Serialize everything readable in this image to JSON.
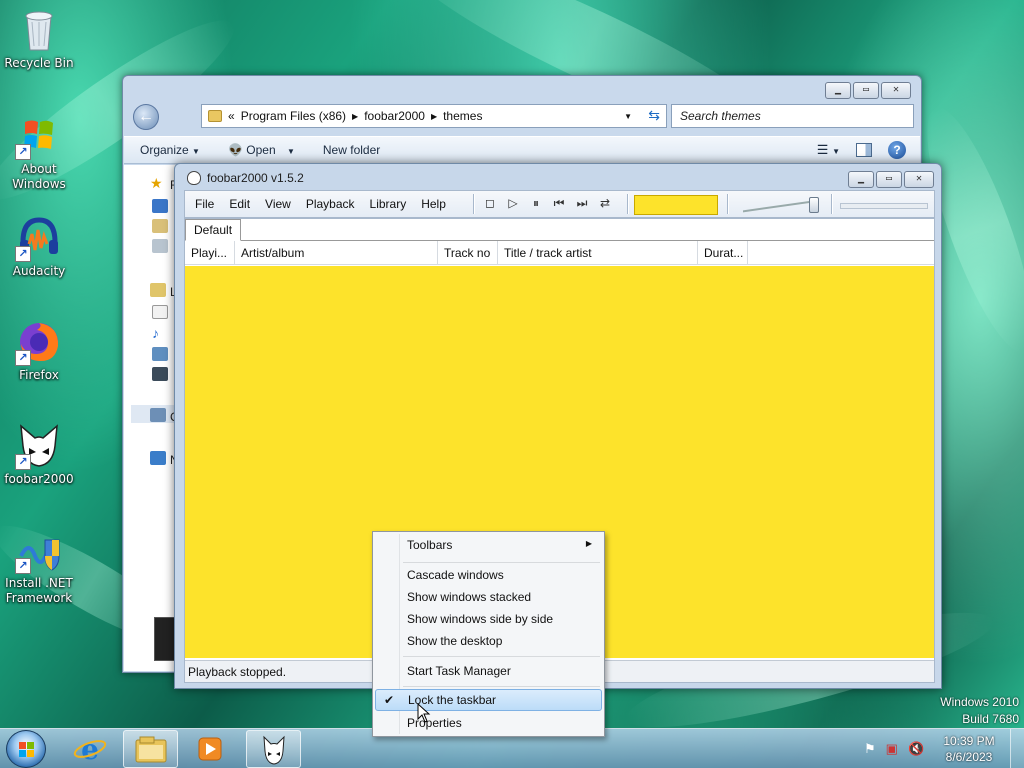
{
  "desktop": {
    "icons": [
      {
        "label": "Recycle Bin",
        "icon": "recycle-bin-icon"
      },
      {
        "label": "About Windows",
        "icon": "windows-logo-icon"
      },
      {
        "label": "Audacity",
        "icon": "audacity-icon"
      },
      {
        "label": "Firefox",
        "icon": "firefox-icon"
      },
      {
        "label": "foobar2000",
        "icon": "foobar2000-icon"
      },
      {
        "label": "Install .NET Framework",
        "icon": "dotnet-installer-icon"
      }
    ],
    "watermark": {
      "line1": "Windows 2010",
      "line2": "Build 7680"
    }
  },
  "explorer": {
    "address": {
      "overflow": "«",
      "crumbs": [
        "Program Files (x86)",
        "foobar2000",
        "themes"
      ]
    },
    "search_placeholder": "Search themes",
    "toolbar": {
      "organize": "Organize",
      "open": "Open",
      "new_folder": "New folder"
    },
    "nav_letters": [
      "F",
      "L",
      "C",
      "N"
    ]
  },
  "foobar": {
    "title": "foobar2000 v1.5.2",
    "menu": [
      "File",
      "Edit",
      "View",
      "Playback",
      "Library",
      "Help"
    ],
    "tab": "Default",
    "columns": [
      "Playi...",
      "Artist/album",
      "Track no",
      "Title / track artist",
      "Durat..."
    ],
    "status": "Playback stopped.",
    "colors": {
      "playlist_bg": "#fde32b"
    }
  },
  "context_menu": {
    "items": [
      {
        "label": "Toolbars",
        "submenu": true
      },
      {
        "label": "Cascade windows"
      },
      {
        "label": "Show windows stacked"
      },
      {
        "label": "Show windows side by side"
      },
      {
        "label": "Show the desktop"
      },
      {
        "label": "Start Task Manager"
      },
      {
        "label": "Lock the taskbar",
        "checked": true,
        "highlighted": true
      },
      {
        "label": "Properties"
      }
    ]
  },
  "taskbar": {
    "time": "10:39 PM",
    "date": "8/6/2023"
  }
}
